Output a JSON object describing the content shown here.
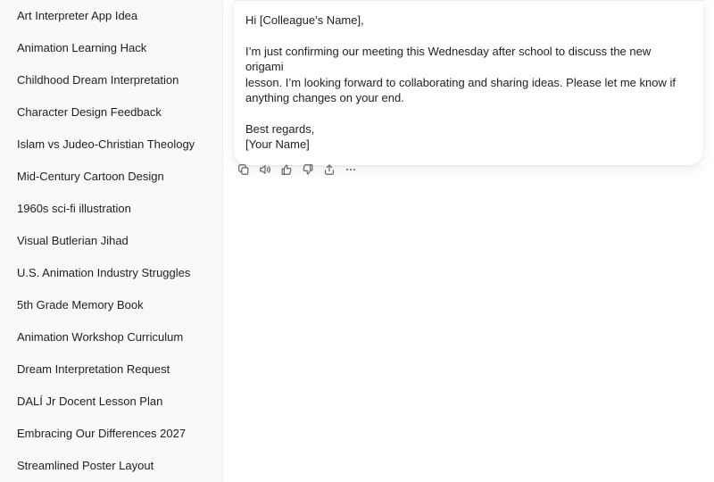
{
  "sidebar": {
    "items": [
      {
        "label": "Art Interpreter App Idea"
      },
      {
        "label": "Animation Learning Hack"
      },
      {
        "label": "Childhood Dream Interpretation"
      },
      {
        "label": "Character Design Feedback"
      },
      {
        "label": "Islam vs Judeo-Christian Theology"
      },
      {
        "label": "Mid-Century Cartoon Design"
      },
      {
        "label": "1960s sci-fi illustration"
      },
      {
        "label": "Visual Butlerian Jihad"
      },
      {
        "label": "U.S. Animation Industry Struggles"
      },
      {
        "label": "5th Grade Memory Book"
      },
      {
        "label": "Animation Workshop Curriculum"
      },
      {
        "label": "Dream Interpretation Request"
      },
      {
        "label": "DALÍ Jr Docent Lesson Plan"
      },
      {
        "label": "Embracing Our Differences 2027"
      },
      {
        "label": "Streamlined Poster Layout"
      }
    ]
  },
  "message": {
    "greeting": "Hi [Colleague’s Name],",
    "body_line1": "I’m just confirming our meeting this Wednesday after school to discuss the new origami",
    "body_line2": "lesson. I’m looking forward to collaborating and sharing ideas. Please let me know if",
    "body_line3": "anything changes on your end.",
    "closing": "Best regards,",
    "signature": "[Your Name]"
  },
  "actions": [
    {
      "icon": "copy-icon"
    },
    {
      "icon": "read-aloud-icon"
    },
    {
      "icon": "thumbs-up-icon"
    },
    {
      "icon": "thumbs-down-icon"
    },
    {
      "icon": "share-icon"
    },
    {
      "icon": "more-icon"
    }
  ],
  "colors": {
    "sidebar_bg": "#f9f9f9",
    "text": "#1f1f1f",
    "icon": "#5d5d5d"
  }
}
